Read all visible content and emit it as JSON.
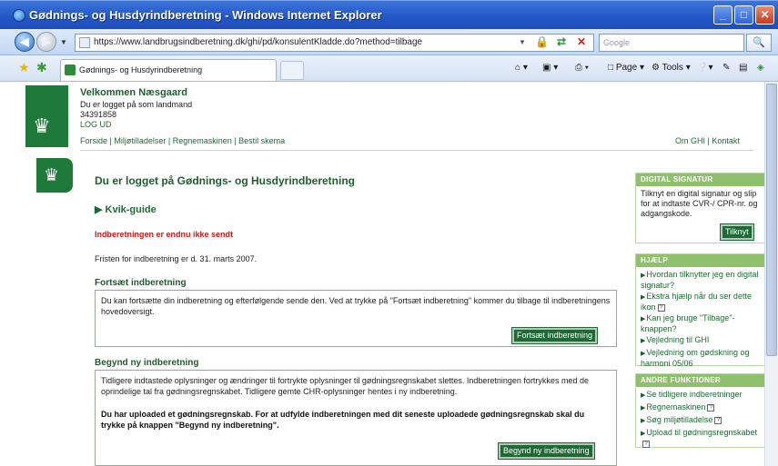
{
  "window": {
    "title": "Gødnings- og Husdyrindberetning - Windows Internet Explorer",
    "minimize": "_",
    "maximize": "□",
    "close": "✕"
  },
  "address": {
    "url": "https://www.landbrugsindberetning.dk/ghi/pd/konsulentKladde.do?method=tilbage",
    "search_placeholder": "Google",
    "search_icon": "search-icon"
  },
  "tabs": {
    "active_tab": "Gødnings- og Husdyrindberetning",
    "commands": [
      "Page",
      "Tools"
    ]
  },
  "header": {
    "welcome": "Velkommen Næsgaard",
    "logged_in_as": "Du er logget på som landmand",
    "number": "34391858",
    "logout": "LOG UD",
    "nav": [
      "Forside",
      "Miljøtilladelser",
      "Regnemaskinen",
      "Bestil skema"
    ],
    "nav_right": [
      "Om GHI",
      "Kontakt"
    ]
  },
  "main": {
    "title": "Du er logget på Gødnings- og Husdyrindberetning",
    "kvik_guide": "Kvik-guide",
    "warning": "Indberetningen er endnu ikke sendt",
    "deadline": "Fristen for indberetning er d. 31. marts 2007.",
    "continue_section": {
      "title": "Fortsæt indberetning",
      "text": "Du kan fortsætte din indberetning og efterfølgende sende den. Ved at trykke på \"Fortsæt indberetning\" kommer du tilbage til indberetningens hovedoversigt.",
      "button": "Fortsæt indberetning"
    },
    "new_section": {
      "title": "Begynd ny indberetning",
      "text": "Tidligere indtastede oplysninger og ændringer til fortrykte oplysninger til gødningsregnskabet slettes. Indberetningen fortrykkes med de oprindelige tal fra gødningsregnskabet. Tidligere gemte CHR-oplysninger hentes i ny indberetning.",
      "bold_text": "Du har uploaded et gødningsregnskab. For at udfylde indberetningen med dit seneste uploadede gødningsregnskab skal du trykke på knappen \"Begynd ny indberetning\".",
      "button": "Begynd ny indberetning"
    }
  },
  "sidebar": {
    "digital_signatur": {
      "heading": "DIGITAL SIGNATUR",
      "text": "Tilknyt en digital signatur og slip for at indtaste CVR-/ CPR-nr. og adgangskode.",
      "button": "Tilknyt"
    },
    "hjaelp": {
      "heading": "HJÆLP",
      "links": [
        "Hvordan tilknytter jeg en digital signatur?",
        "Ekstra hjælp når du ser dette ikon",
        "Kan jeg bruge \"Tilbage\"-knappen?",
        "Vejledning til GHI",
        "Vejledning om gødskning og harmoni 05/06"
      ]
    },
    "andre_funktioner": {
      "heading": "ANDRE FUNKTIONER",
      "links": [
        "Se tidligere indberetninger",
        "Regnemaskinen",
        "Søg miljøtilladelse",
        "Upload til gødningsregnskabet"
      ]
    }
  }
}
